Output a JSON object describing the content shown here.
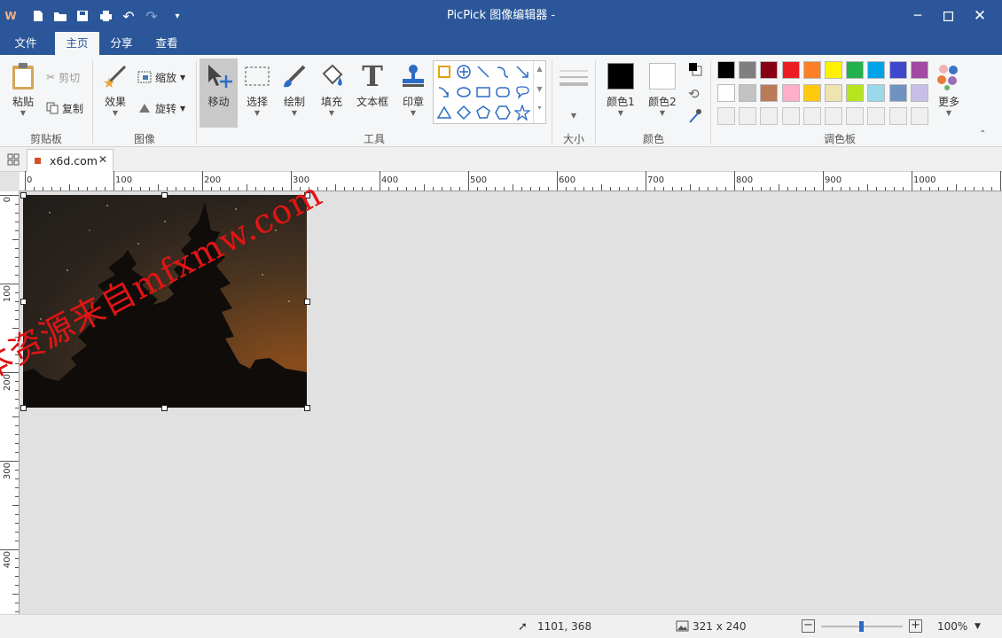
{
  "app": {
    "title": "PicPick 图像编辑器 -"
  },
  "ribbon_tabs": [
    {
      "label": "文件"
    },
    {
      "label": "主页",
      "active": true
    },
    {
      "label": "分享"
    },
    {
      "label": "查看"
    }
  ],
  "clipboard": {
    "paste": "粘贴",
    "cut": "剪切",
    "copy": "复制",
    "group": "剪贴板"
  },
  "image_group": {
    "effects": "效果",
    "resize": "缩放",
    "rotate": "旋转",
    "group": "图像"
  },
  "tools_group": {
    "move": "移动",
    "select": "选择",
    "draw": "绘制",
    "fill": "填充",
    "textbox": "文本框",
    "stamp": "印章",
    "group": "工具"
  },
  "size_group": {
    "group": "大小"
  },
  "color_group": {
    "color1": "颜色1",
    "color2": "颜色2",
    "group": "颜色",
    "color1_value": "#000000",
    "color2_value": "#ffffff"
  },
  "palette_group": {
    "more": "更多",
    "group": "调色板",
    "row1": [
      "#000000",
      "#7f7f7f",
      "#880015",
      "#ed1c24",
      "#ff7f27",
      "#fff200",
      "#22b14c",
      "#00a2e8",
      "#3f48cc",
      "#a349a4"
    ],
    "row2": [
      "#ffffff",
      "#c3c3c3",
      "#b97a57",
      "#ffaec9",
      "#ffc90e",
      "#efe4b0",
      "#b5e61d",
      "#99d9ea",
      "#7092be",
      "#c8bfe7"
    ]
  },
  "document": {
    "tab_label": "x6d.com"
  },
  "ruler": {
    "h": [
      "0",
      "100",
      "200",
      "300",
      "400",
      "500",
      "600",
      "700",
      "800",
      "900",
      "1000"
    ],
    "v": [
      "0",
      "100",
      "200",
      "300",
      "400"
    ]
  },
  "watermark": "本资源来自mfxmw.com",
  "status": {
    "cursor": "1101, 368",
    "dimensions": "321 x 240",
    "zoom": "100%"
  },
  "colors": {
    "title_bar": "#2b579a",
    "ribbon_bg": "#f5f6f7",
    "accent": "#2b579a"
  }
}
